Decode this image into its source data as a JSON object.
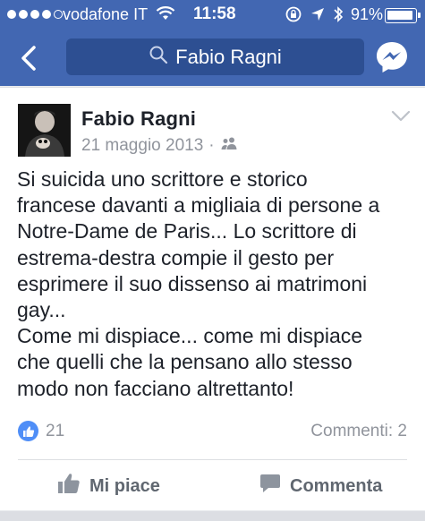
{
  "status_bar": {
    "carrier": "vodafone IT",
    "time": "11:58",
    "battery_percent": "91%",
    "signal_bars_filled": 4,
    "signal_bars_total": 5
  },
  "nav": {
    "search_text": "Fabio Ragni"
  },
  "post": {
    "author": "Fabio Ragni",
    "date": "21 maggio 2013",
    "separator": "·",
    "audience_icon": "friends-icon",
    "text": "Si suicida uno scrittore e storico\nfrancese davanti a migliaia di persone a\nNotre-Dame de Paris... Lo scrittore di\nestrema-destra compie il gesto per\nesprimere il suo dissenso ai matrimoni\ngay...\nCome mi dispiace... come mi dispiace\nche quelli che la pensano allo stesso\nmodo non facciano altrettanto!",
    "like_count": "21",
    "comments_label": "Commenti: 2"
  },
  "actions": {
    "like_label": "Mi piace",
    "comment_label": "Commenta"
  },
  "colors": {
    "navbar": "#4267b2",
    "search_bg": "#2d4f92",
    "like_badge": "#4f8ef7",
    "meta_gray": "#90949c"
  }
}
